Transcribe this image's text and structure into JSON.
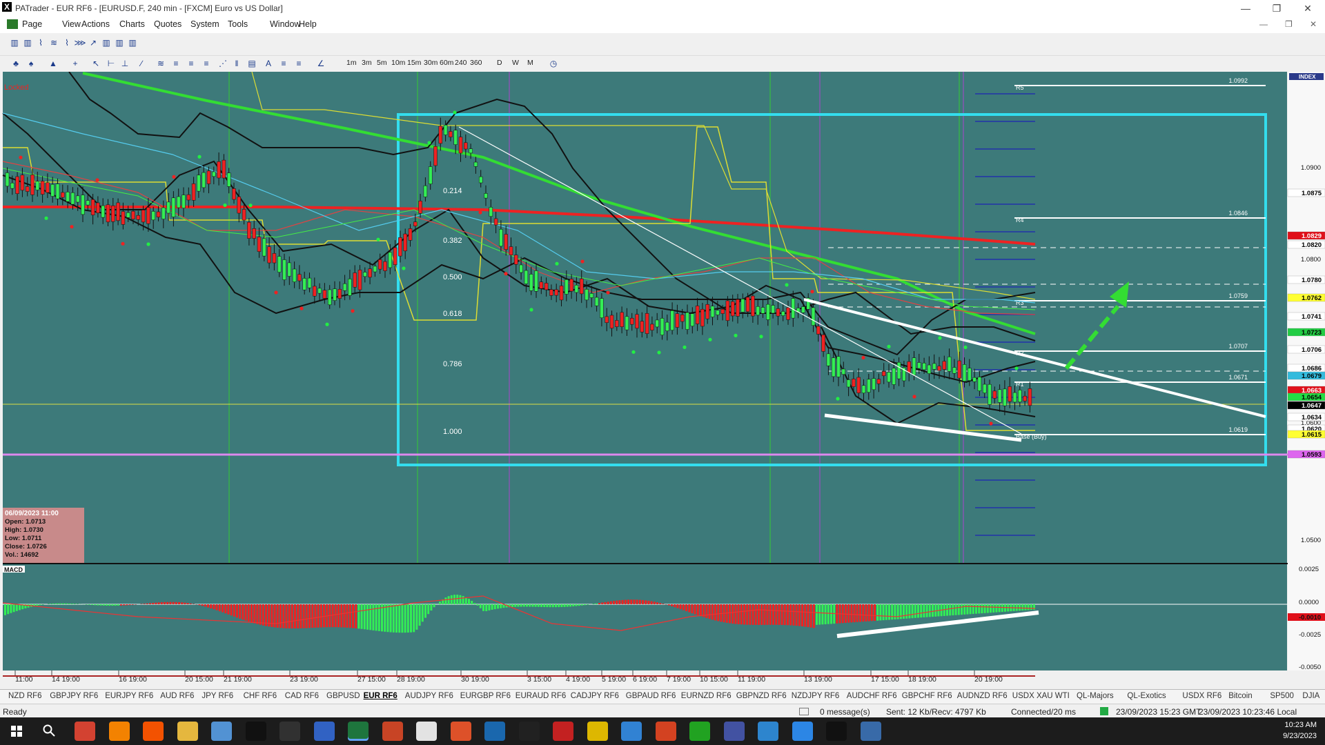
{
  "window": {
    "title": "PATrader - EUR RF6 - [EURUSD.F, 240 min - [FXCM] Euro vs US Dollar]",
    "logo": "X"
  },
  "menu": [
    "Page",
    "View",
    "Actions",
    "Charts",
    "Quotes",
    "System",
    "Tools",
    "Window",
    "Help"
  ],
  "timeframes": [
    "1m",
    "3m",
    "5m",
    "10m",
    "15m",
    "30m",
    "60m",
    "240",
    "360",
    "D",
    "W",
    "M"
  ],
  "chart": {
    "locked_label": "Locked",
    "index_label": "INDEX",
    "macd_label": "MACD",
    "fib_levels": [
      "0.214",
      "0.382",
      "0.500",
      "0.618",
      "0.786",
      "1.000"
    ],
    "price_scale": [
      "1.0900",
      "1.0800",
      "1.0700",
      "1.0600",
      "1.0500"
    ],
    "price_tags": [
      {
        "v": "1.0875",
        "bg": "#ffffff",
        "fg": "#000"
      },
      {
        "v": "1.0829",
        "bg": "#e0101a",
        "fg": "#fff"
      },
      {
        "v": "1.0820",
        "bg": "#ffffff",
        "fg": "#000"
      },
      {
        "v": "1.0780",
        "bg": "#ffffff",
        "fg": "#000"
      },
      {
        "v": "1.0762",
        "bg": "#ffff33",
        "fg": "#000"
      },
      {
        "v": "1.0741",
        "bg": "#ffffff",
        "fg": "#000"
      },
      {
        "v": "1.0723",
        "bg": "#22cc44",
        "fg": "#000"
      },
      {
        "v": "1.0706",
        "bg": "#ffffff",
        "fg": "#000"
      },
      {
        "v": "1.0686",
        "bg": "#ffffff",
        "fg": "#000"
      },
      {
        "v": "1.0679",
        "bg": "#33bbdd",
        "fg": "#000"
      },
      {
        "v": "1.0663",
        "bg": "#e0101a",
        "fg": "#fff"
      },
      {
        "v": "1.0654",
        "bg": "#22dd44",
        "fg": "#000"
      },
      {
        "v": "1.0647",
        "bg": "#000000",
        "fg": "#fff"
      },
      {
        "v": "1.0634",
        "bg": "#ffffff",
        "fg": "#000"
      },
      {
        "v": "1.0620",
        "bg": "#ffffff",
        "fg": "#000"
      },
      {
        "v": "1.0615",
        "bg": "#ffff33",
        "fg": "#000"
      },
      {
        "v": "1.0593",
        "bg": "#dd66ee",
        "fg": "#000"
      }
    ],
    "pivots": [
      {
        "label": "R5",
        "value": "1.0992"
      },
      {
        "label": "R4",
        "value": "1.0846"
      },
      {
        "label": "R3",
        "value": "1.0759"
      },
      {
        "label": "R2",
        "value": "1.0707"
      },
      {
        "label": "R1",
        "value": "1.0671"
      },
      {
        "label": "Base (Buy)",
        "value": "1.0619"
      }
    ],
    "macd_scale": [
      "0.0025",
      "0.0000",
      "-0.0025",
      "-0.0050"
    ],
    "macd_tag": "-0.0010",
    "time_axis": [
      "11:00",
      "14 19:00",
      "16 19:00",
      "20 15:00",
      "21 19:00",
      "23 19:00",
      "27 15:00",
      "28 19:00",
      "30 19:00",
      "3 15:00",
      "4 19:00",
      "5 19:00",
      "6 19:00",
      "7 19:00",
      "10 15:00",
      "11 19:00",
      "13 19:00",
      "17 15:00",
      "18 19:00",
      "20 19:00"
    ],
    "info_box": {
      "date": "06/09/2023 11:00",
      "open": "Open: 1.0713",
      "high": "High: 1.0730",
      "low": "Low: 1.0711",
      "close": "Close: 1.0726",
      "vol": "Vol.: 14692"
    },
    "colors": {
      "bg": "#3d7a7a",
      "sma_green": "#33dd33",
      "sma_red": "#ee2222",
      "box": "#33ddee",
      "candle_up": "#33ee55",
      "candle_down": "#ee2222"
    }
  },
  "tabs": [
    "NZD RF6",
    "GBPJPY RF6",
    "EURJPY RF6",
    "AUD RF6",
    "JPY RF6",
    "CHF RF6",
    "CAD RF6",
    "GBPUSD",
    "EUR RF6",
    "AUDJPY RF6",
    "EURGBP RF6",
    "EURAUD RF6",
    "CADJPY RF6",
    "GBPAUD RF6",
    "EURNZD RF6",
    "GBPNZD RF6",
    "NZDJPY RF6",
    "AUDCHF RF6",
    "GBPCHF RF6",
    "AUDNZD RF6",
    "USDX XAU WTI",
    "QL-Majors",
    "QL-Exotics",
    "USDX RF6",
    "Bitcoin",
    "SP500",
    "DJIA"
  ],
  "active_tab": "EUR RF6",
  "status": {
    "ready": "Ready",
    "messages": "0 message(s)",
    "sent": "Sent: 12 Kb/Recv: 4797 Kb",
    "connected": "Connected/20 ms",
    "gmt": "23/09/2023 15:23 GMT",
    "local": "23/09/2023 10:23:46 Local"
  },
  "clock": {
    "time": "10:23 AM",
    "date": "9/23/2023"
  }
}
